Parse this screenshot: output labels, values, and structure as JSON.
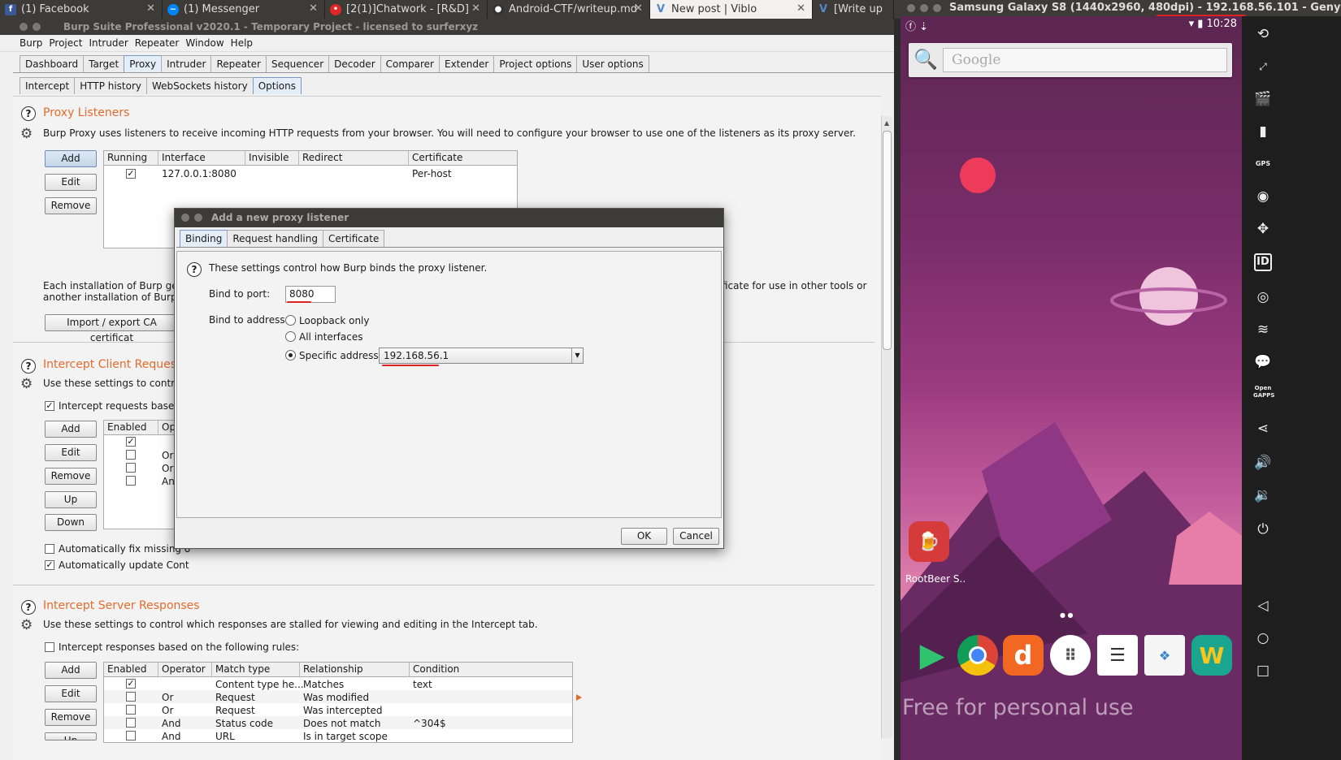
{
  "browser_tabs": [
    {
      "label": "(1) Facebook",
      "icon": "facebook-icon",
      "color": "#3b5998"
    },
    {
      "label": "(1) Messenger",
      "icon": "messenger-icon",
      "color": "#0084ff"
    },
    {
      "label": "[2(1)]Chatwork - [R&D]",
      "icon": "chatwork-icon",
      "color": "#e02727"
    },
    {
      "label": "Android-CTF/writeup.md",
      "icon": "github-icon",
      "color": "#333333"
    },
    {
      "label": "New post | Viblo",
      "icon": "viblo-icon",
      "color": "#5387c6"
    },
    {
      "label": "[Write up",
      "icon": "viblo-icon",
      "color": "#5387c6"
    }
  ],
  "burp": {
    "title": "Burp Suite Professional v2020.1 - Temporary Project - licensed to surferxyz",
    "menu": [
      "Burp",
      "Project",
      "Intruder",
      "Repeater",
      "Window",
      "Help"
    ],
    "main_tabs": [
      "Dashboard",
      "Target",
      "Proxy",
      "Intruder",
      "Repeater",
      "Sequencer",
      "Decoder",
      "Comparer",
      "Extender",
      "Project options",
      "User options"
    ],
    "active_main_tab": "Proxy",
    "sub_tabs": [
      "Intercept",
      "HTTP history",
      "WebSockets history",
      "Options"
    ],
    "active_sub_tab": "Options",
    "listeners": {
      "title": "Proxy Listeners",
      "description": "Burp Proxy uses listeners to receive incoming HTTP requests from your browser. You will need to configure your browser to use one of the listeners as its proxy server.",
      "buttons": [
        "Add",
        "Edit",
        "Remove"
      ],
      "columns": [
        "Running",
        "Interface",
        "Invisible",
        "Redirect",
        "Certificate"
      ],
      "rows": [
        {
          "running": true,
          "interface": "127.0.0.1:8080",
          "invisible": "",
          "redirect": "",
          "certificate": "Per-host"
        }
      ],
      "ca_text_1": "Each installation of Burp gene",
      "ca_text_1b": "ficate for use in other tools or",
      "ca_text_2": "another installation of Burp.",
      "import_button": "Import / export CA certificat"
    },
    "client": {
      "title": "Intercept Client Reques",
      "description": "Use these settings to control v",
      "checkbox_label": "Intercept requests based o",
      "buttons": [
        "Add",
        "Edit",
        "Remove",
        "Up",
        "Down"
      ],
      "columns": [
        "Enabled",
        "Op"
      ],
      "rows": [
        {
          "enabled": true,
          "op": ""
        },
        {
          "enabled": false,
          "op": "Or"
        },
        {
          "enabled": false,
          "op": "Or"
        },
        {
          "enabled": false,
          "op": "An"
        }
      ],
      "fix_label": "Automatically fix missing o",
      "update_label": "Automatically update Cont"
    },
    "server": {
      "title": "Intercept Server Responses",
      "description": "Use these settings to control which responses are stalled for viewing and editing in the Intercept tab.",
      "checkbox_label": "Intercept responses based on the following rules:",
      "buttons": [
        "Add",
        "Edit",
        "Remove",
        "Up"
      ],
      "columns": [
        "Enabled",
        "Operator",
        "Match type",
        "Relationship",
        "Condition"
      ],
      "rows": [
        {
          "enabled": true,
          "operator": "",
          "match": "Content type he...",
          "rel": "Matches",
          "cond": "text"
        },
        {
          "enabled": false,
          "operator": "Or",
          "match": "Request",
          "rel": "Was modified",
          "cond": ""
        },
        {
          "enabled": false,
          "operator": "Or",
          "match": "Request",
          "rel": "Was intercepted",
          "cond": ""
        },
        {
          "enabled": false,
          "operator": "And",
          "match": "Status code",
          "rel": "Does not match",
          "cond": "^304$"
        },
        {
          "enabled": false,
          "operator": "And",
          "match": "URL",
          "rel": "Is in target scope",
          "cond": ""
        }
      ]
    }
  },
  "dialog": {
    "title": "Add a new proxy listener",
    "tabs": [
      "Binding",
      "Request handling",
      "Certificate"
    ],
    "active_tab": "Binding",
    "info": "These settings control how Burp binds the proxy listener.",
    "port_label": "Bind to port:",
    "port_value": "8080",
    "address_label": "Bind to address:",
    "options": [
      "Loopback only",
      "All interfaces",
      "Specific address:"
    ],
    "selected_option": "Specific address:",
    "specific_address": "192.168.56.1",
    "ok": "OK",
    "cancel": "Cancel"
  },
  "genymotion": {
    "title_prefix": "Samsung Galaxy S8 (1440x2960, 480dpi) - ",
    "title_ip": "192.168.56.101",
    "title_suffix": " - Geny",
    "time": "10:28",
    "search_placeholder": "Google",
    "app_label": "RootBeer S..",
    "watermark": "Free for personal use",
    "dock_apps": [
      "play-store-icon",
      "chrome-icon",
      "d-app-icon",
      "app-drawer-icon",
      "notes-icon",
      "newscope-icon",
      "w-app-icon"
    ],
    "sidebar_icons": [
      "rotate-icon",
      "pixel-ratio-icon",
      "camera-icon",
      "battery-icon",
      "gps-icon",
      "webcam-icon",
      "dpad-icon",
      "id-icon",
      "disk-icon",
      "feed-icon",
      "sms-icon",
      "opengapps-icon",
      "share-icon",
      "volume-up-icon",
      "volume-down-icon",
      "power-icon",
      "back-icon",
      "home-icon",
      "recents-icon"
    ],
    "gps_label": "GPS",
    "opengapps_label": "Open GAPPS"
  }
}
